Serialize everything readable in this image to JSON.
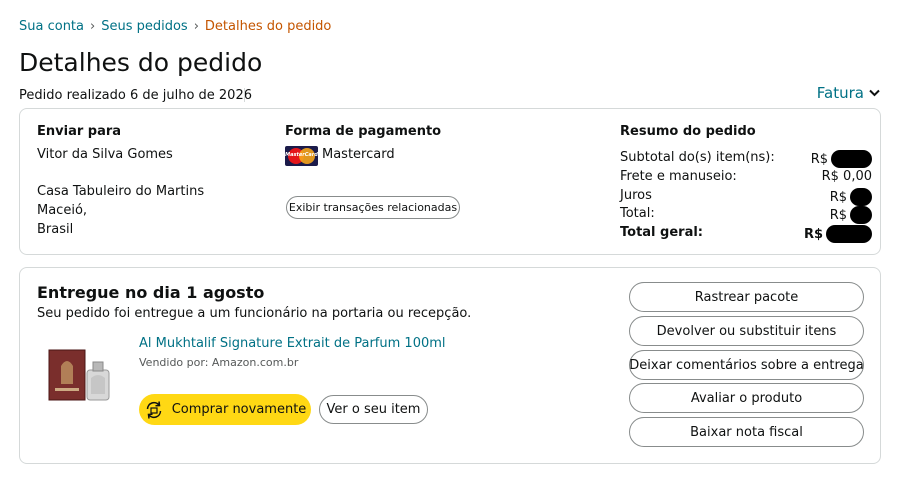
{
  "breadcrumb": {
    "items": [
      "Sua conta",
      "Seus pedidos"
    ],
    "separator": "›",
    "current": "Detalhes do pedido"
  },
  "page": {
    "title": "Detalhes do pedido",
    "order_date": "Pedido realizado 6 de julho de 2026",
    "invoice_label": "Fatura"
  },
  "shipping": {
    "heading": "Enviar para",
    "name": "Vitor da Silva Gomes",
    "address_line1": "Casa Tabuleiro do Martins",
    "city": "Maceió,",
    "country": "Brasil"
  },
  "payment": {
    "heading": "Forma de pagamento",
    "method": "Mastercard",
    "logo_text": "MasterCard",
    "related_transactions_label": "Exibir transações relacionadas"
  },
  "summary": {
    "heading": "Resumo do pedido",
    "rows": [
      {
        "label": "Subtotal do(s) item(ns):",
        "value": "R$"
      },
      {
        "label": "Frete e manuseio:",
        "value": "R$ 0,00"
      },
      {
        "label": "Juros",
        "value": "R$"
      },
      {
        "label": "Total:",
        "value": "R$"
      },
      {
        "label": "Total geral:",
        "value": "R$"
      }
    ]
  },
  "delivery": {
    "title": "Entregue no dia 1 agosto",
    "subtitle": "Seu pedido foi entregue a um funcionário na portaria ou recepção."
  },
  "item": {
    "title": "Al Mukhtalif Signature Extrait de Parfum 100ml",
    "seller": "Vendido por: Amazon.com.br",
    "buy_again_label": "Comprar novamente",
    "view_item_label": "Ver o seu item"
  },
  "actions": [
    "Rastrear pacote",
    "Devolver ou substituir itens",
    "Deixar comentários sobre a entrega",
    "Avaliar o produto",
    "Baixar nota fiscal"
  ],
  "colors": {
    "link": "#007185",
    "breadcrumb_current": "#c45500",
    "buy_again_bg": "#ffd814",
    "border": "#d5d9d9"
  }
}
